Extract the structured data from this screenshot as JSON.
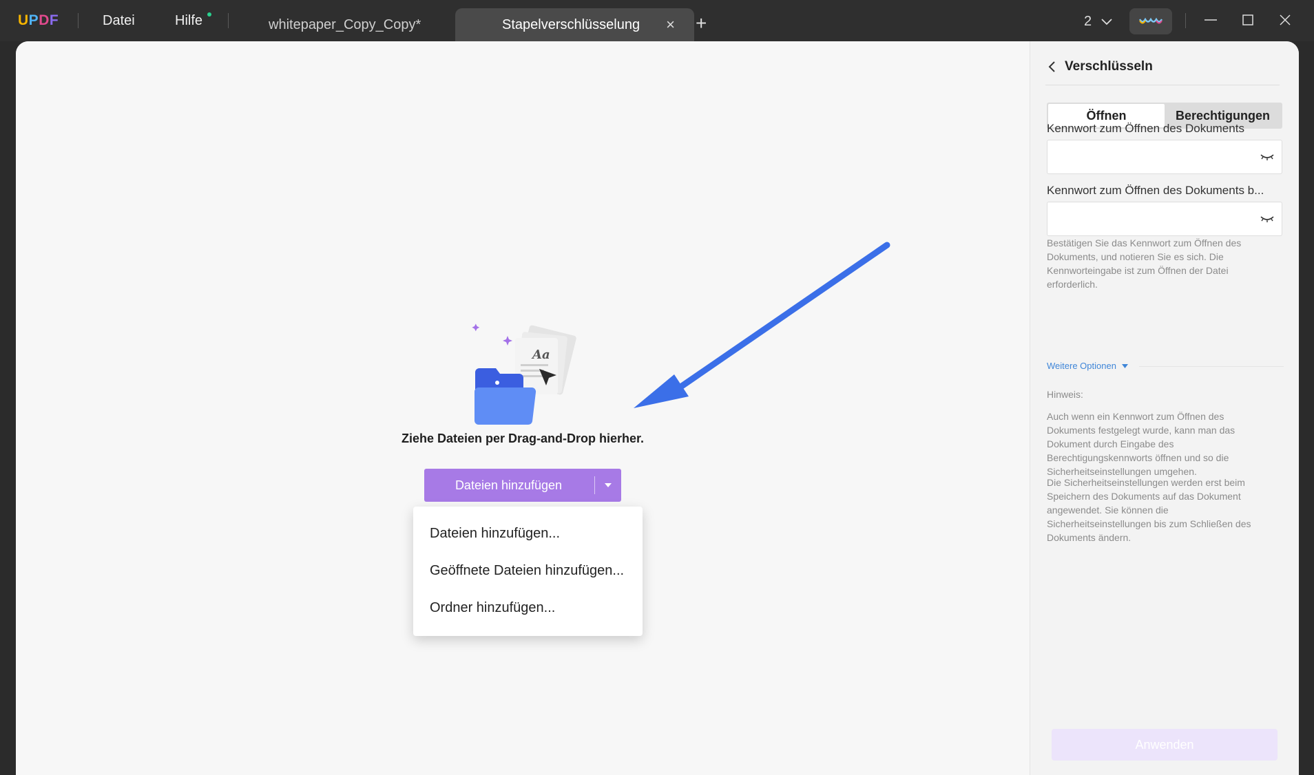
{
  "app": {
    "logo": {
      "u": "U",
      "p": "P",
      "d": "D",
      "f": "F"
    },
    "menu": {
      "file": "Datei",
      "help": "Hilfe"
    },
    "tabs": [
      {
        "label": "whitepaper_Copy_Copy*",
        "active": false
      },
      {
        "label": "Stapelverschlüsselung",
        "active": true
      }
    ],
    "tab_close_icon": "×",
    "new_tab_icon": "+",
    "window_count": "2",
    "colors": {
      "accent": "#a77ae6",
      "link": "#3f86d8",
      "arrow": "#3b6fe8"
    }
  },
  "workspace": {
    "drop_text": "Ziehe Dateien per Drag-and-Drop hierher.",
    "add_button": "Dateien hinzufügen",
    "dropdown": [
      "Dateien hinzufügen...",
      "Geöffnete Dateien hinzufügen...",
      "Ordner hinzufügen..."
    ]
  },
  "panel": {
    "title": "Verschlüsseln",
    "segments": {
      "open": "Öffnen",
      "permissions": "Berechtigungen",
      "active": "open"
    },
    "open_password_label": "Kennwort zum Öffnen des Dokuments",
    "open_password_value": "",
    "confirm_password_label": "Kennwort zum Öffnen des Dokuments b...",
    "confirm_password_value": "",
    "confirm_help": "Bestätigen Sie das Kennwort zum Öffnen des Dokuments, und notieren Sie es sich. Die Kennworteingabe ist zum Öffnen der Datei erforderlich.",
    "more_options": "Weitere Optionen",
    "note_title": "Hinweis:",
    "note_1": "Auch wenn ein Kennwort zum Öffnen des Dokuments festgelegt wurde, kann man das Dokument durch Eingabe des Berechtigungskennworts öffnen und so die Sicherheitseinstellungen umgehen.",
    "note_2": "Die Sicherheitseinstellungen werden erst beim Speichern des Dokuments auf das Dokument angewendet. Sie können die Sicherheitseinstellungen bis zum Schließen des Dokuments ändern.",
    "apply_button": "Anwenden"
  }
}
